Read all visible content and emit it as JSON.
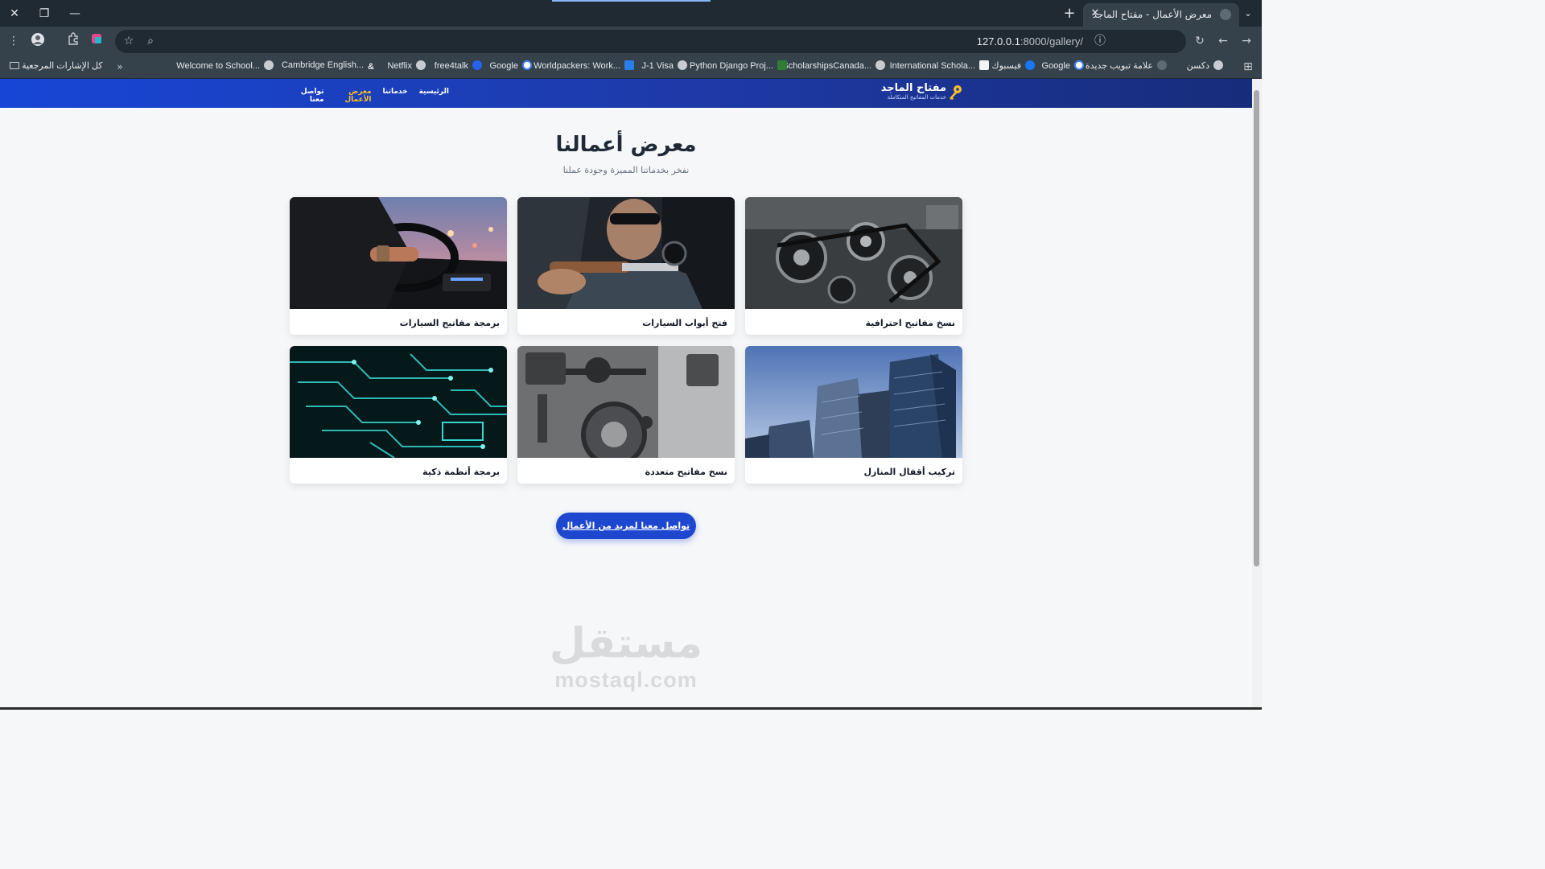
{
  "browser": {
    "tab_title": "معرض الأعمال - مفتاح الماجد",
    "url_host": "127.0.0.1",
    "url_path": ":8000/gallery/",
    "bookmarks": [
      {
        "label": "دكسن"
      },
      {
        "label": "علامة تبويب جديدة"
      },
      {
        "label": "Google"
      },
      {
        "label": "فيسبوك"
      },
      {
        "label": "International Schola..."
      },
      {
        "label": "ScholarshipsCanada..."
      },
      {
        "label": "Python Django Proj..."
      },
      {
        "label": "J-1 Visa"
      },
      {
        "label": "Worldpackers: Work..."
      },
      {
        "label": "Google"
      },
      {
        "label": "free4talk"
      },
      {
        "label": "Netflix"
      },
      {
        "label": "Cambridge English..."
      },
      {
        "label": "Welcome to School..."
      }
    ],
    "all_bookmarks": "كل الإشارات المرجعية"
  },
  "site": {
    "brand_name": "مفتاح الماجد",
    "brand_tagline": "خدمات المفاتيح المتكاملة",
    "nav": [
      {
        "label": "الرئيسية"
      },
      {
        "label": "خدماتنا"
      },
      {
        "label": "معرض الأعمال",
        "active": true
      },
      {
        "label": "تواصل معنا"
      }
    ],
    "accent_color": "#1e47d0",
    "active_nav_color": "#fbbf24"
  },
  "gallery": {
    "title": "معرض أعمالنا",
    "subtitle": "نفخر بخدماتنا المميزة وجودة عملنا",
    "items": [
      {
        "caption": "نسخ مفاتيح احترافية",
        "image": "car-engine-photo"
      },
      {
        "caption": "فتح أبواب السيارات",
        "image": "technician-tool-photo"
      },
      {
        "caption": "برمجة مفاتيح السيارات",
        "image": "car-driver-photo"
      },
      {
        "caption": "تركيب أقفال المنازل",
        "image": "skyscrapers-photo"
      },
      {
        "caption": "نسخ مفاتيح متعددة",
        "image": "vault-door-photo"
      },
      {
        "caption": "برمجة أنظمة ذكية",
        "image": "circuit-board-photo"
      }
    ],
    "cta_label": "تواصل معنا لمزيد من الأعمال"
  },
  "watermark": {
    "arabic": "مستقل",
    "latin": "mostaql.com"
  }
}
